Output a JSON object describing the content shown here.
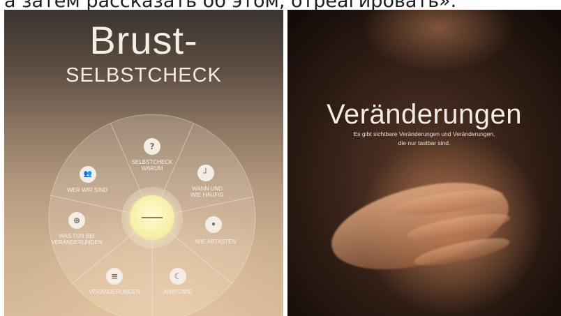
{
  "caption": "а затем рассказать об этом, отреагировать».",
  "left_screen": {
    "title": "Brust-",
    "subtitle": "SELBSTCHECK",
    "menu": [
      {
        "label": "SELBSTCHECK\nWARUM",
        "icon": "question-icon"
      },
      {
        "label": "WANN UND\nWIE HÄUFIG",
        "icon": "clock-icon"
      },
      {
        "label": "WIE ABTASTEN",
        "icon": "touch-icon"
      },
      {
        "label": "ANATOMIE",
        "icon": "anatomy-icon"
      },
      {
        "label": "VERÄNDERUNGEN",
        "icon": "list-icon"
      },
      {
        "label": "WAS TUN BEI\nVERÄNDERUNGEN",
        "icon": "magnifier-icon"
      },
      {
        "label": "WER WIR SIND",
        "icon": "people-icon"
      }
    ],
    "center_button_symbol": "—"
  },
  "right_screen": {
    "title": "Veränderungen",
    "subtitle_line1": "Es gibt sichtbare Veränderungen und Veränderungen,",
    "subtitle_line2": "die nur tastbar sind."
  }
}
